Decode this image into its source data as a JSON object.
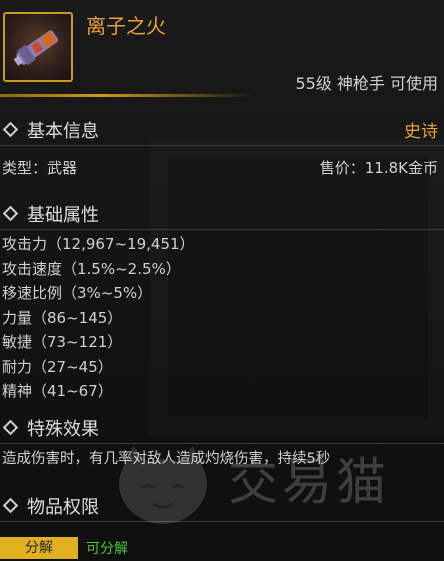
{
  "item": {
    "name": "离子之火",
    "requirement": "55级 神枪手 可使用",
    "icon": "weapon-icon"
  },
  "basic_info": {
    "title": "基本信息",
    "rarity": "史诗",
    "type": "类型：武器",
    "price": "售价：11.8K金币"
  },
  "attributes": {
    "title": "基础属性",
    "stats": [
      "攻击力（12,967~19,451）",
      "攻击速度（1.5%~2.5%）",
      "移速比例（3%~5%）",
      "力量（86~145）",
      "敏捷（73~121）",
      "耐力（27~45）",
      "精神（41~67）"
    ]
  },
  "special": {
    "title": "特殊效果",
    "text": "造成伤害时，有几率对敌人造成灼烧伤害，持续5秒"
  },
  "permissions": {
    "title": "物品权限",
    "tag": "分解",
    "status": "可分解"
  },
  "watermark": {
    "text": "交易猫",
    "icon": "cat-logo-icon"
  },
  "colors": {
    "accent_gold": "#e8a23a",
    "tag_yellow": "#e0b020",
    "status_green": "#4cc63a"
  }
}
